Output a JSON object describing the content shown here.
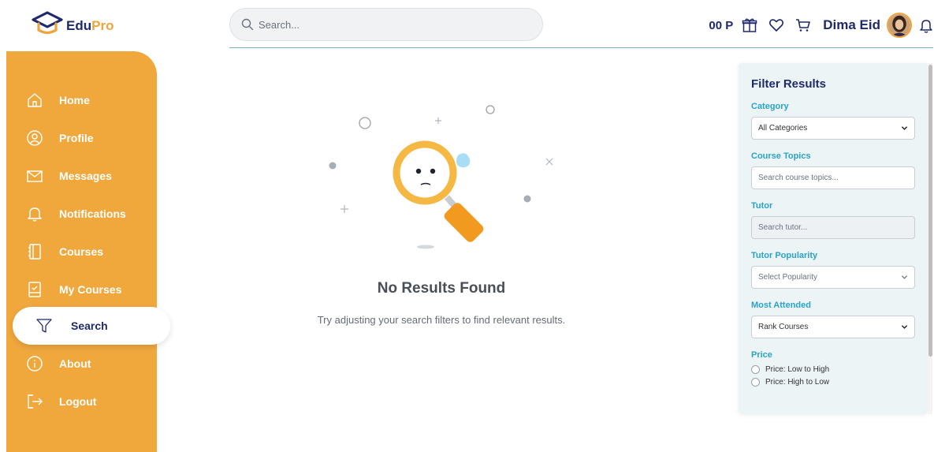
{
  "brand": {
    "name_part1": "Edu",
    "name_part2": "Pro"
  },
  "search": {
    "placeholder": "Search..."
  },
  "header": {
    "points": "00 P",
    "user_name": "Dima Eid"
  },
  "sidebar": {
    "items": [
      {
        "label": "Home",
        "icon": "home-icon",
        "active": false
      },
      {
        "label": "Profile",
        "icon": "user-circle-icon",
        "active": false
      },
      {
        "label": "Messages",
        "icon": "envelope-icon",
        "active": false
      },
      {
        "label": "Notifications",
        "icon": "bell-icon",
        "active": false
      },
      {
        "label": "Courses",
        "icon": "book-icon",
        "active": false
      },
      {
        "label": "My Courses",
        "icon": "checked-book-icon",
        "active": false
      },
      {
        "label": "Search",
        "icon": "filter-icon",
        "active": true
      },
      {
        "label": "About",
        "icon": "info-icon",
        "active": false
      },
      {
        "label": "Logout",
        "icon": "logout-icon",
        "active": false
      }
    ]
  },
  "empty_state": {
    "title": "No Results Found",
    "message": "Try adjusting your search filters to find relevant results."
  },
  "filters": {
    "title": "Filter Results",
    "category": {
      "label": "Category",
      "value": "All Categories"
    },
    "topics": {
      "label": "Course Topics",
      "placeholder": "Search course topics..."
    },
    "tutor": {
      "label": "Tutor",
      "placeholder": "Search tutor..."
    },
    "popularity": {
      "label": "Tutor Popularity",
      "value": "Select Popularity"
    },
    "attended": {
      "label": "Most Attended",
      "value": "Rank Courses"
    },
    "price": {
      "label": "Price",
      "options": [
        "Price: Low to High",
        "Price: High to Low"
      ]
    }
  },
  "colors": {
    "sidebar": "#f0a83d",
    "navy": "#1f2a6e",
    "accent_blue": "#2aa3c9",
    "filter_bg": "#ecf4f6"
  }
}
